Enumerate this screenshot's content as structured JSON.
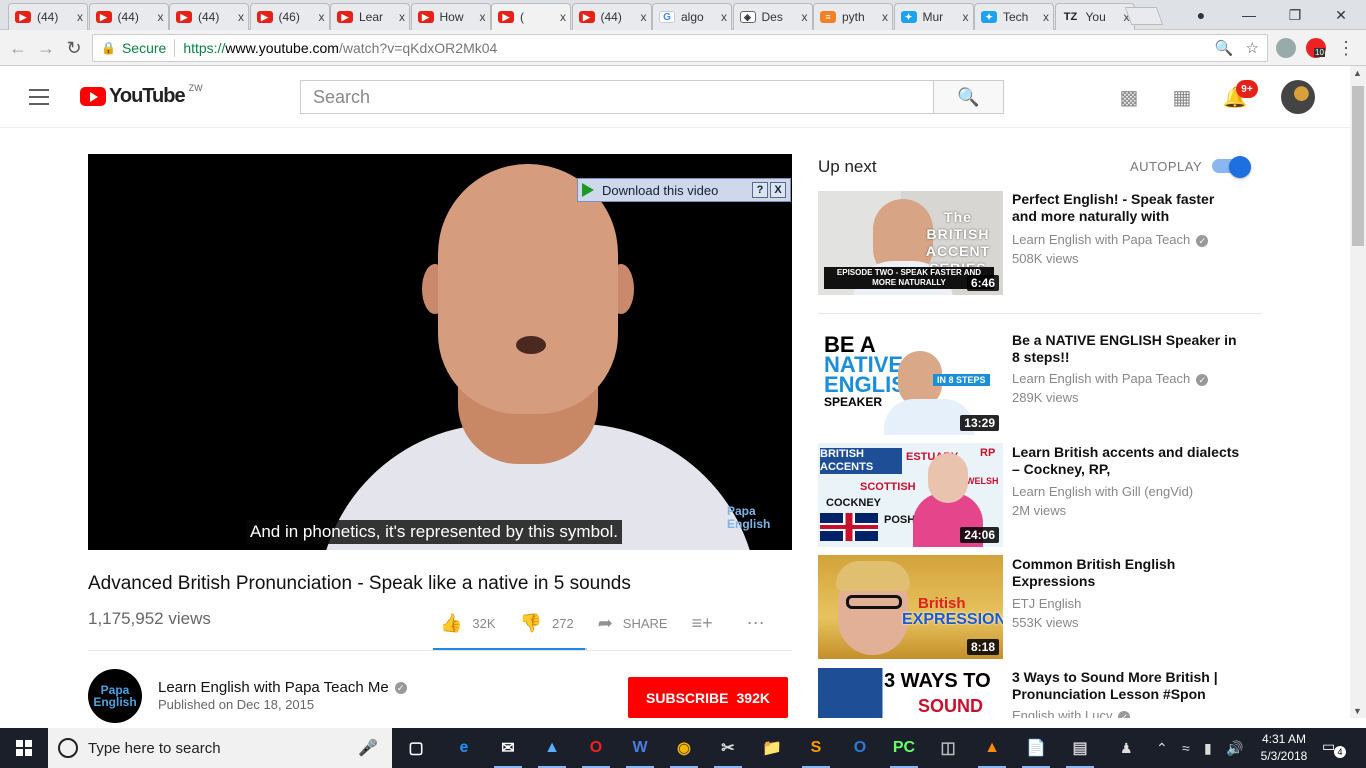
{
  "browser": {
    "tabs": [
      {
        "label": "(44)",
        "icon": "youtube"
      },
      {
        "label": "(44)",
        "icon": "youtube"
      },
      {
        "label": "(44)",
        "icon": "youtube"
      },
      {
        "label": "(46)",
        "icon": "youtube"
      },
      {
        "label": "Lear",
        "icon": "youtube"
      },
      {
        "label": "How",
        "icon": "youtube"
      },
      {
        "label": "(",
        "icon": "youtube",
        "active": true
      },
      {
        "label": "(44)",
        "icon": "youtube"
      },
      {
        "label": "algo",
        "icon": "google"
      },
      {
        "label": "Des",
        "icon": "design"
      },
      {
        "label": "pyth",
        "icon": "stackoverflow"
      },
      {
        "label": "Mur",
        "icon": "twitter"
      },
      {
        "label": "Tech",
        "icon": "twitter"
      },
      {
        "label": "You",
        "icon": "tz"
      }
    ],
    "tab_close": "x",
    "favicon_text": {
      "google": "G",
      "tz": "TZ"
    },
    "security_label": "Secure",
    "url_protocol": "https://",
    "url_host": "www.youtube.com",
    "url_path": "/watch?v=qKdxOR2Mk04",
    "extension_badge": "10"
  },
  "youtube": {
    "logo_text": "YouTube",
    "country_code": "ZW",
    "search_placeholder": "Search",
    "notification_count": "9+"
  },
  "player": {
    "download_label": "Download this video",
    "download_help": "?",
    "download_close": "X",
    "caption": "And in phonetics, it's represented by this symbol.",
    "watermark_line1": "Papa",
    "watermark_line2": "English"
  },
  "video": {
    "title": "Advanced British Pronunciation - Speak like a native in 5 sounds",
    "views": "1,175,952 views",
    "likes": "32K",
    "dislikes": "272",
    "share_label": "SHARE",
    "like_ratio": 0.99,
    "channel_name": "Learn English with Papa Teach Me",
    "channel_avatar_line1": "Papa",
    "channel_avatar_line2": "English",
    "published": "Published on Dec 18, 2015",
    "subscribe_label": "SUBSCRIBE",
    "subscriber_count": "392K"
  },
  "sidebar": {
    "up_next_label": "Up next",
    "autoplay_label": "AUTOPLAY",
    "autoplay_on": true,
    "recommendations": [
      {
        "title": "Perfect English! - Speak faster and more naturally with",
        "channel": "Learn English with Papa Teach",
        "views": "508K views",
        "duration": "6:46",
        "thumb_text": "The BRITISH ACCENT SERIES",
        "thumb_strip": "EPISODE TWO - SPEAK FASTER AND MORE NATURALLY"
      },
      {
        "title": "Be a NATIVE ENGLISH Speaker in 8 steps!!",
        "channel": "Learn English with Papa Teach",
        "views": "289K views",
        "duration": "13:29",
        "thumb_line1": "BE A",
        "thumb_line2": "NATIVE",
        "thumb_line3": "ENGLISH",
        "thumb_line4": "SPEAKER",
        "thumb_tag": "IN 8 STEPS"
      },
      {
        "title": "Learn British accents and dialects – Cockney, RP,",
        "channel": "Learn English with Gill (engVid)",
        "views": "2M views",
        "duration": "24:06",
        "thumb_labels": [
          "BRITISH ACCENTS",
          "ESTUARY",
          "RP",
          "SCOTTISH",
          "WELSH",
          "COCKNEY",
          "POSH"
        ]
      },
      {
        "title": "Common British English Expressions",
        "channel": "ETJ English",
        "views": "553K views",
        "duration": "8:18",
        "thumb_line1": "British",
        "thumb_line2": "EXPRESSIONS"
      },
      {
        "title": "3 Ways to Sound More British | Pronunciation Lesson #Spon",
        "channel": "English with Lucy",
        "thumb_line1": "3 WAYS TO",
        "thumb_line2": "SOUND"
      }
    ]
  },
  "taskbar": {
    "search_placeholder": "Type here to search",
    "time": "4:31 AM",
    "date": "5/3/2018",
    "notification_count": "4"
  }
}
